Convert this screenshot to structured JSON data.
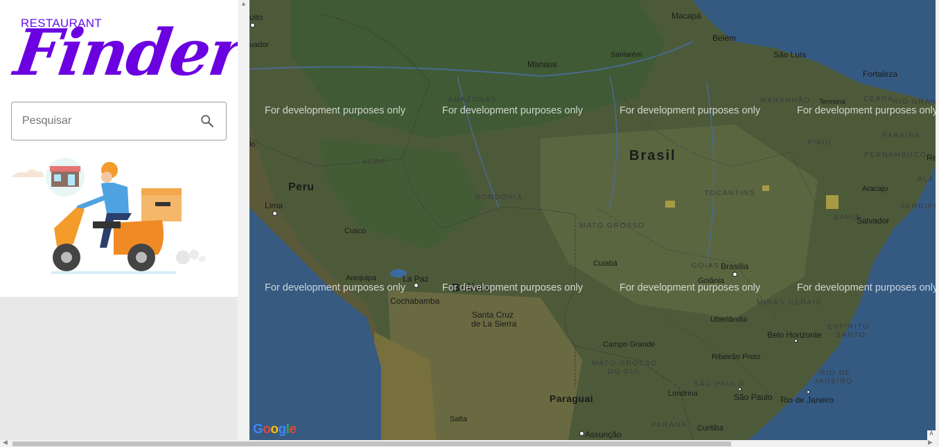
{
  "logo": {
    "small": "RESTAURANT",
    "big": "Finder"
  },
  "search": {
    "placeholder": "Pesquisar"
  },
  "map": {
    "watermark": "For development purposes only",
    "google": [
      "G",
      "o",
      "o",
      "g",
      "l",
      "e"
    ],
    "google_colors": [
      "#4285f4",
      "#ea4335",
      "#fbbc05",
      "#4285f4",
      "#34a853",
      "#ea4335"
    ],
    "corner": "A",
    "countries": {
      "brasil": "Brasil",
      "peru": "Peru",
      "bolivia": "Bolívia",
      "paraguai": "Paraguai"
    },
    "states": {
      "amazonas": "AMAZONAS",
      "acre": "ACRE",
      "rondonia": "RONDÔNIA",
      "mato_grosso": "MATO GROSSO",
      "tocantins": "TOCANTINS",
      "goias": "GOIÁS",
      "minas": "MINAS GERAIS",
      "msul_1": "MATO GROSSO",
      "msul_2": "DO SUL",
      "sao_paulo": "SÃO PAULO",
      "parana": "PARANÁ",
      "maranhao": "MARANHÃO",
      "ceara": "CEARÁ",
      "piaui": "PIAUÍ",
      "pernambuco": "PERNAMBUCO",
      "paraiba": "PARAÍBA",
      "bahia": "BAHIA",
      "sergipe": "SERGIPE",
      "alagoas": "ALA",
      "rio_grande": "RIO GRAND",
      "espirito_1": "ESPÍRITO",
      "espirito_2": "SANTO",
      "rio_1": "RIO DE",
      "rio_2": "JANEIRO"
    },
    "cities": {
      "quito": "uito",
      "equador": "uador",
      "macapa": "Macapá",
      "belem": "Belém",
      "sao_luis": "São Luís",
      "fortaleza": "Fortaleza",
      "teresina": "Teresina",
      "manaus": "Manaus",
      "santarem": "Santarém",
      "lima": "Lima",
      "cusco": "Cusco",
      "arequipa": "Arequipa",
      "la_paz": "La Paz",
      "cochabamba": "Cochabamba",
      "santa_cruz_1": "Santa Cruz",
      "santa_cruz_2": "de La Sierra",
      "cuiaba": "Cuiabá",
      "brasilia": "Brasília",
      "goiania": "Goiânia",
      "uberlandia": "Uberlândia",
      "belo_horizonte": "Belo Horizonte",
      "campo_grande": "Campo Grande",
      "ribeirao": "Ribeirão Preto",
      "londrina": "Londrina",
      "sao_paulo": "São Paulo",
      "rio": "Rio de Janeiro",
      "curitiba": "Curitiba",
      "assuncao": "Assunção",
      "salta": "Salta",
      "salvador": "Salvador",
      "aracaju": "Aracaju",
      "recife": "Re",
      "l1": "lo"
    }
  }
}
